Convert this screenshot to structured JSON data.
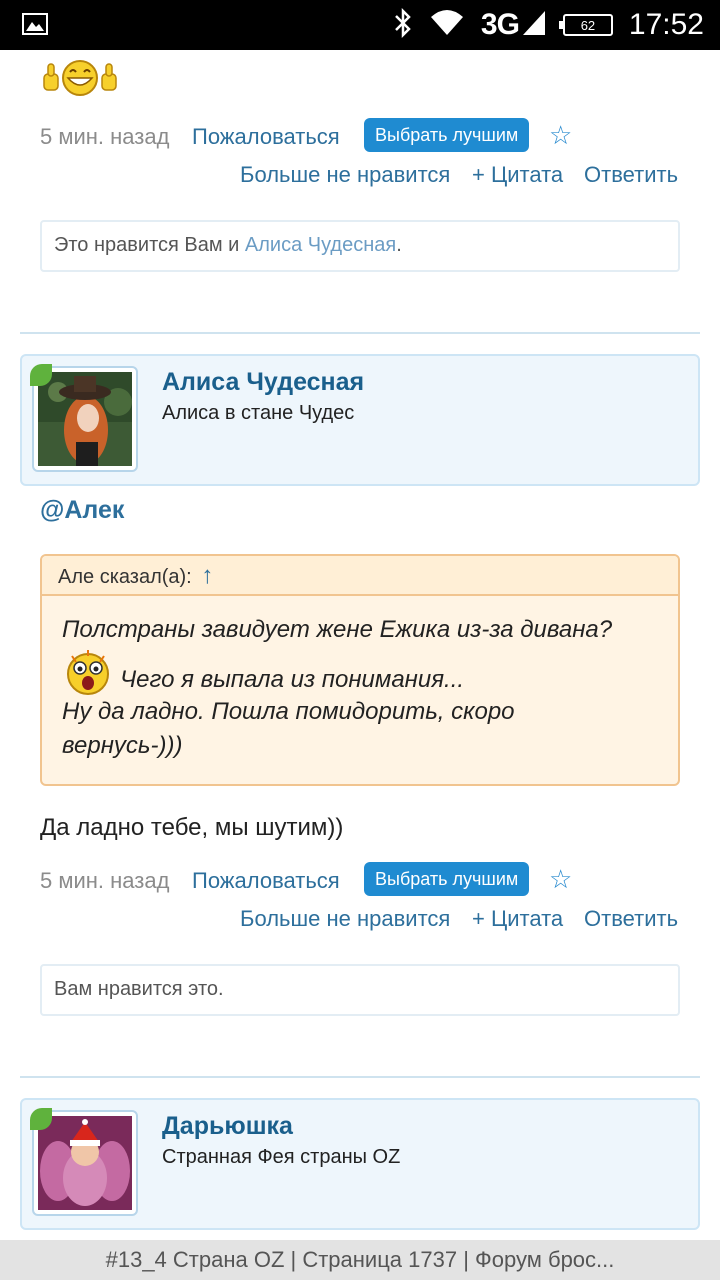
{
  "status_bar": {
    "time": "17:52",
    "network": "3G",
    "battery": "62",
    "icons": [
      "image-icon",
      "bluetooth-icon",
      "wifi-icon",
      "signal-icon",
      "battery-icon"
    ]
  },
  "post1": {
    "emoji": "thumbs-up-smiley-icon",
    "time": "5 мин. назад",
    "report": "Пожаловаться",
    "best": "Выбрать лучшим",
    "star": "☆",
    "unlike": "Больше не нравится",
    "quote": "+ Цитата",
    "reply": "Ответить",
    "likes_prefix": "Это нравится Вам и ",
    "likes_name": "Алиса Чудесная",
    "likes_suffix": "."
  },
  "post2": {
    "author": "Алиса Чудесная",
    "subtitle": "Алиса в стане Чудес",
    "mention": "@Алек",
    "quote_author": "Але сказал(а):",
    "quote_arrow": "↑",
    "quote_line1": "Полстраны завидует жене Ежика из-за дивана?",
    "quote_line2": "Чего я выпала из понимания...",
    "quote_line3": "Ну да ладно. Пошла помидорить, скоро",
    "quote_line4": "вернусь-)))",
    "text": "Да ладно тебе, мы шутим))",
    "time": "5 мин. назад",
    "report": "Пожаловаться",
    "best": "Выбрать лучшим",
    "star": "☆",
    "unlike": "Больше не нравится",
    "quote": "+ Цитата",
    "reply": "Ответить",
    "likes": "Вам нравится это."
  },
  "post3": {
    "author": "Дарьюшка",
    "subtitle": "Странная Фея страны OZ"
  },
  "page_title": "#13_4 Страна OZ | Страница 1737 | Форум брос..."
}
